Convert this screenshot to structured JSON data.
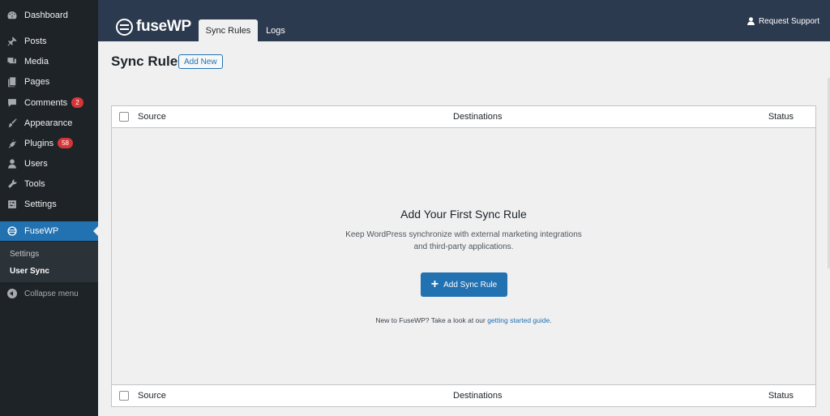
{
  "sidebar": {
    "items": [
      {
        "label": "Dashboard"
      },
      {
        "label": "Posts"
      },
      {
        "label": "Media"
      },
      {
        "label": "Pages"
      },
      {
        "label": "Comments",
        "badge": "2"
      },
      {
        "label": "Appearance"
      },
      {
        "label": "Plugins",
        "badge": "58"
      },
      {
        "label": "Users"
      },
      {
        "label": "Tools"
      },
      {
        "label": "Settings"
      },
      {
        "label": "FuseWP"
      }
    ],
    "submenu": [
      {
        "label": "Settings"
      },
      {
        "label": "User Sync"
      }
    ],
    "collapse_label": "Collapse menu"
  },
  "header": {
    "logo_text": "fuseWP",
    "tabs": [
      {
        "label": "Sync Rules",
        "active": true
      },
      {
        "label": "Logs",
        "active": false
      }
    ],
    "support_label": "Request Support"
  },
  "page": {
    "title": "Sync Rules",
    "add_new_label": "Add New"
  },
  "table": {
    "columns": [
      "Source",
      "Destinations",
      "Status"
    ],
    "empty": {
      "title": "Add Your First Sync Rule",
      "description": "Keep WordPress synchronize with external marketing integrations and third-party applications.",
      "button_label": "Add Sync Rule",
      "help_text": "New to FuseWP? Take a look at our",
      "help_link": "getting started guide",
      "help_end": "."
    }
  },
  "colors": {
    "sidebar_bg": "#1d2327",
    "header_bg": "#2c3a4f",
    "accent": "#2271b1",
    "badge": "#d63638"
  }
}
